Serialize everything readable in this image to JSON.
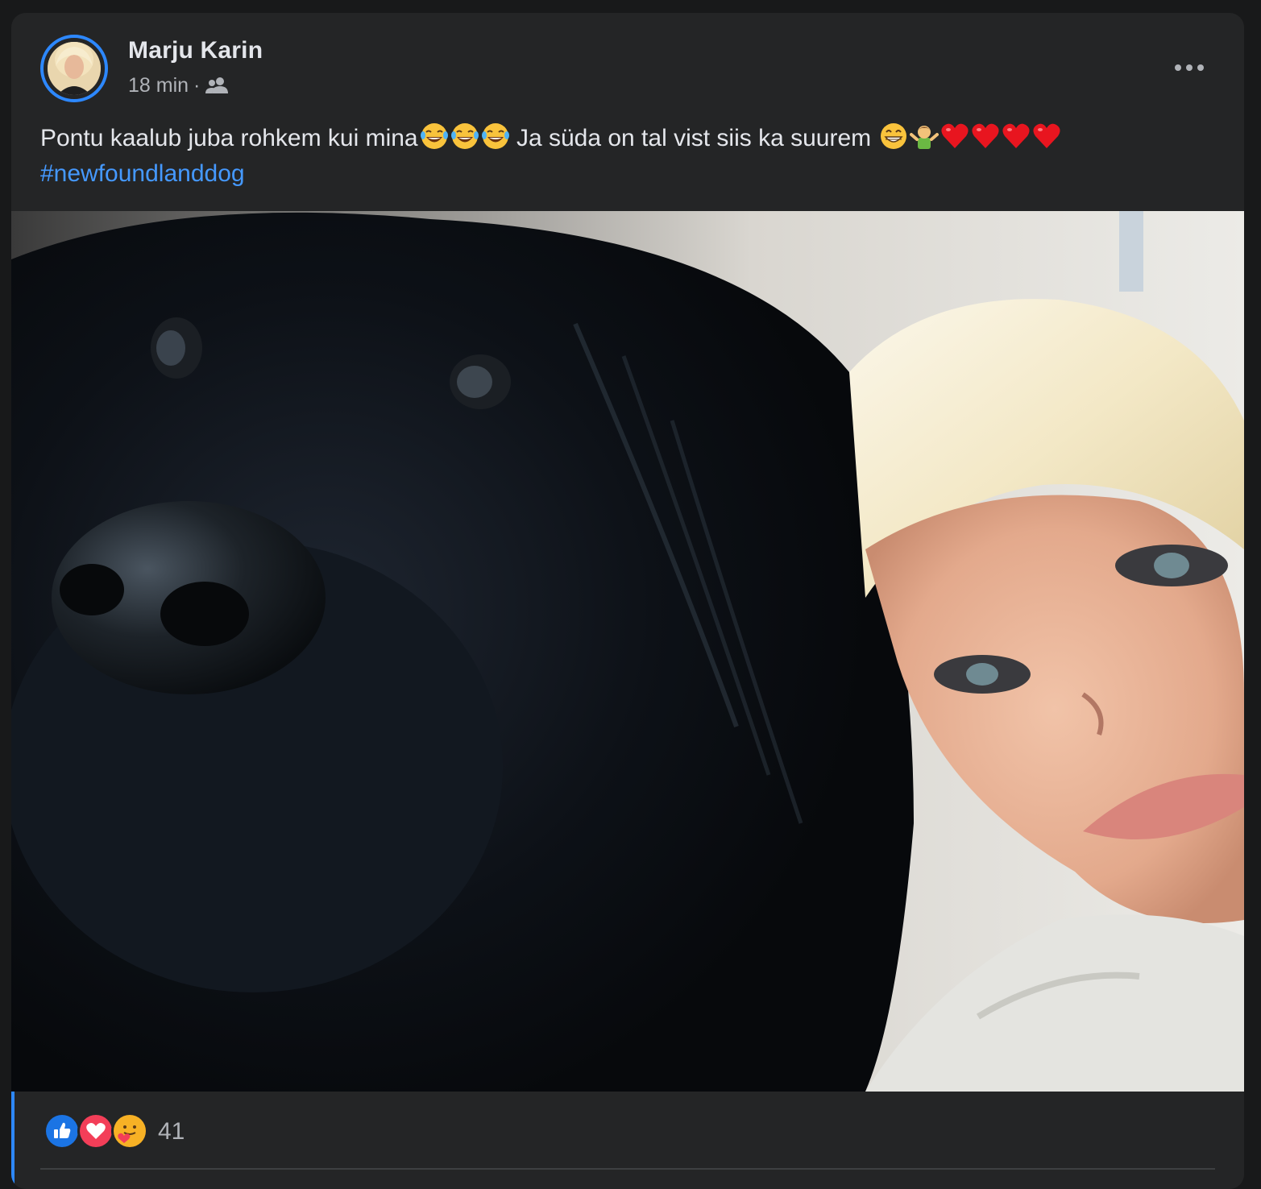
{
  "post": {
    "author": "Marju Karin",
    "time": "18 min",
    "separator": "·",
    "audience_icon": "friends-icon",
    "more_icon": "more-horizontal-icon",
    "text_part1": "Pontu kaalub juba rohkem kui mina",
    "text_part2": " Ja süda on tal vist siis ka suurem ",
    "emoji_sequence_1": [
      "tears-of-joy-emoji",
      "tears-of-joy-emoji",
      "tears-of-joy-emoji"
    ],
    "emoji_sequence_2": [
      "grinning-emoji",
      "man-shrugging-emoji",
      "red-heart-emoji",
      "red-heart-emoji",
      "red-heart-emoji",
      "red-heart-emoji"
    ],
    "hashtag": "#newfoundlanddog",
    "photo_description_icon": "photo"
  },
  "reactions": {
    "types": [
      "like-icon",
      "love-icon",
      "care-icon"
    ],
    "count": "41"
  },
  "colors": {
    "background": "#18191a",
    "card": "#242526",
    "text_primary": "#e4e6eb",
    "text_secondary": "#b0b3b8",
    "accent": "#2d88ff",
    "hashtag": "#4599ff"
  }
}
